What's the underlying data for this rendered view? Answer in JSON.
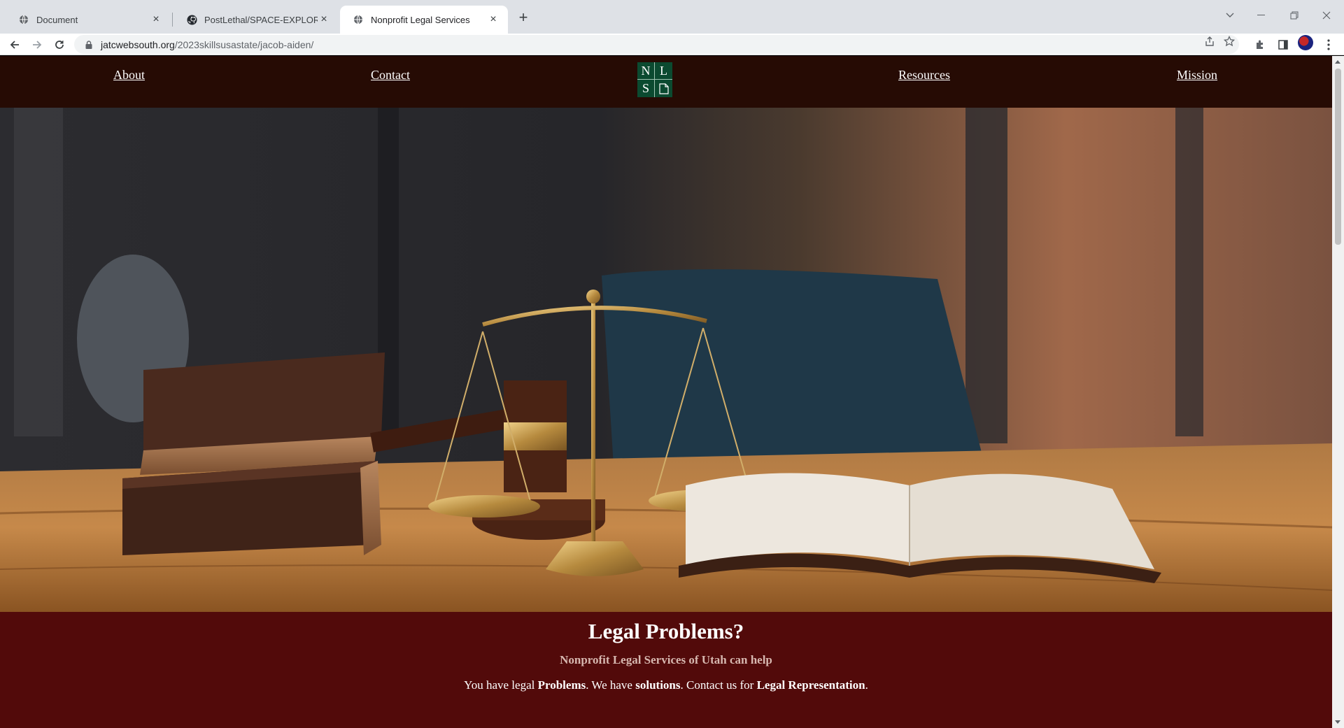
{
  "browser": {
    "tabs": [
      {
        "title": "Document",
        "favicon": "globe-icon",
        "active": false
      },
      {
        "title": "PostLethal/SPACE-EXPLORATION",
        "favicon": "github-icon",
        "active": false
      },
      {
        "title": "Nonprofit Legal Services",
        "favicon": "globe-icon",
        "active": true
      }
    ],
    "address": {
      "domain": "jatcwebsouth.org",
      "path": "/2023skillsusastate/jacob-aiden/"
    }
  },
  "nav": {
    "links": [
      "About",
      "Contact",
      "Resources",
      "Mission"
    ],
    "logo": {
      "n": "N",
      "l": "L",
      "s": "S",
      "icon": "document-icon"
    }
  },
  "hero": {
    "image": "scales-of-justice-gavel-books-on-desk"
  },
  "banner": {
    "heading": "Legal Problems?",
    "subtitle": "Nonprofit Legal Services of Utah can help",
    "tagline": {
      "t1": "You have legal ",
      "b1": "Problems",
      "t2": ". We have ",
      "b2": "solutions",
      "t3": ". Contact us for ",
      "b3": "Legal Representation",
      "t4": "."
    }
  },
  "colors": {
    "nav_bg": "#260b04",
    "banner_bg": "#520a0a",
    "logo_bg": "#0b4a30",
    "subtitle": "#d7b8b0"
  }
}
